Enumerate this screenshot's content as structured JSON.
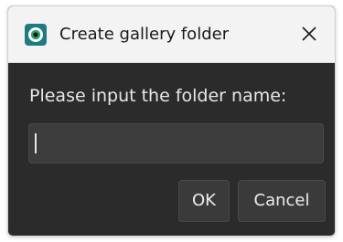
{
  "window": {
    "title": "Create gallery folder",
    "app_icon": "app-logo-icon",
    "close_icon": "close-icon"
  },
  "form": {
    "prompt": "Please input the folder name:",
    "folder_name_value": "",
    "folder_name_placeholder": ""
  },
  "buttons": {
    "ok_label": "OK",
    "cancel_label": "Cancel"
  },
  "colors": {
    "titlebar_bg": "#f3f3f3",
    "dialog_bg": "#2b2b2b",
    "input_bg": "#3c3c3c",
    "button_bg": "#3a3a3a",
    "text_light": "#e8e8e8",
    "logo_teal": "#1f7a83",
    "logo_green": "#2ea36c"
  }
}
